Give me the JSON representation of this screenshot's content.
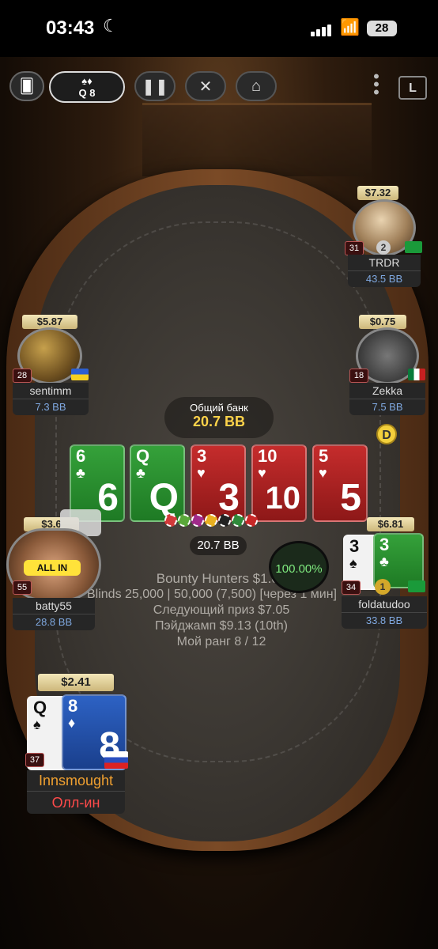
{
  "status_bar": {
    "time": "03:43",
    "battery": "28"
  },
  "toolbar": {
    "hand_cards": "Q 8",
    "hand_suits": "♠♦"
  },
  "pot": {
    "label": "Общий банк",
    "value": "20.7 BB"
  },
  "board": [
    {
      "rank": "6",
      "suit": "♣",
      "color": "#2f9a35"
    },
    {
      "rank": "Q",
      "suit": "♣",
      "color": "#2f9a35"
    },
    {
      "rank": "3",
      "suit": "♥",
      "color": "#b42424"
    },
    {
      "rank": "10",
      "suit": "♥",
      "color": "#b42424"
    },
    {
      "rank": "5",
      "suit": "♥",
      "color": "#b42424"
    }
  ],
  "bet": "20.7 BB",
  "equity": "100.00%",
  "dealer_button": "D",
  "tournament": {
    "name": "Bounty Hunters $1.08",
    "blinds": "Blinds 25,000 | 50,000 (7,500) [через 1 мин]",
    "next_prize": "Следующий приз $7.05",
    "pay_jump": "Пэйджамп $9.13 (10th)",
    "rank": "Мой ранг 8 / 12"
  },
  "players": {
    "trdr": {
      "bounty": "$7.32",
      "name": "TRDR",
      "stack": "43.5 BB",
      "level": "31",
      "badge": "2"
    },
    "sentimm": {
      "bounty": "$5.87",
      "name": "sentimm",
      "stack": "7.3 BB",
      "level": "28"
    },
    "zekka": {
      "bounty": "$0.75",
      "name": "Zekka",
      "stack": "7.5 BB",
      "level": "18"
    },
    "batty": {
      "bounty": "$3.6",
      "name": "batty55",
      "stack": "28.8 BB",
      "level": "55"
    },
    "foldatudoo": {
      "bounty": "$6.81",
      "name": "foldatudoo",
      "stack": "33.8 BB",
      "level": "34",
      "badge": "1",
      "cards": [
        "3",
        "3"
      ]
    },
    "hero": {
      "bounty": "$2.41",
      "name": "Innsmought",
      "status": "Олл-ин",
      "level": "37",
      "cards": [
        "Q",
        "8"
      ]
    }
  },
  "colors": {
    "felt": "#3a3631",
    "accent_gold": "#ffd34a",
    "allin": "#ff4a4a"
  }
}
